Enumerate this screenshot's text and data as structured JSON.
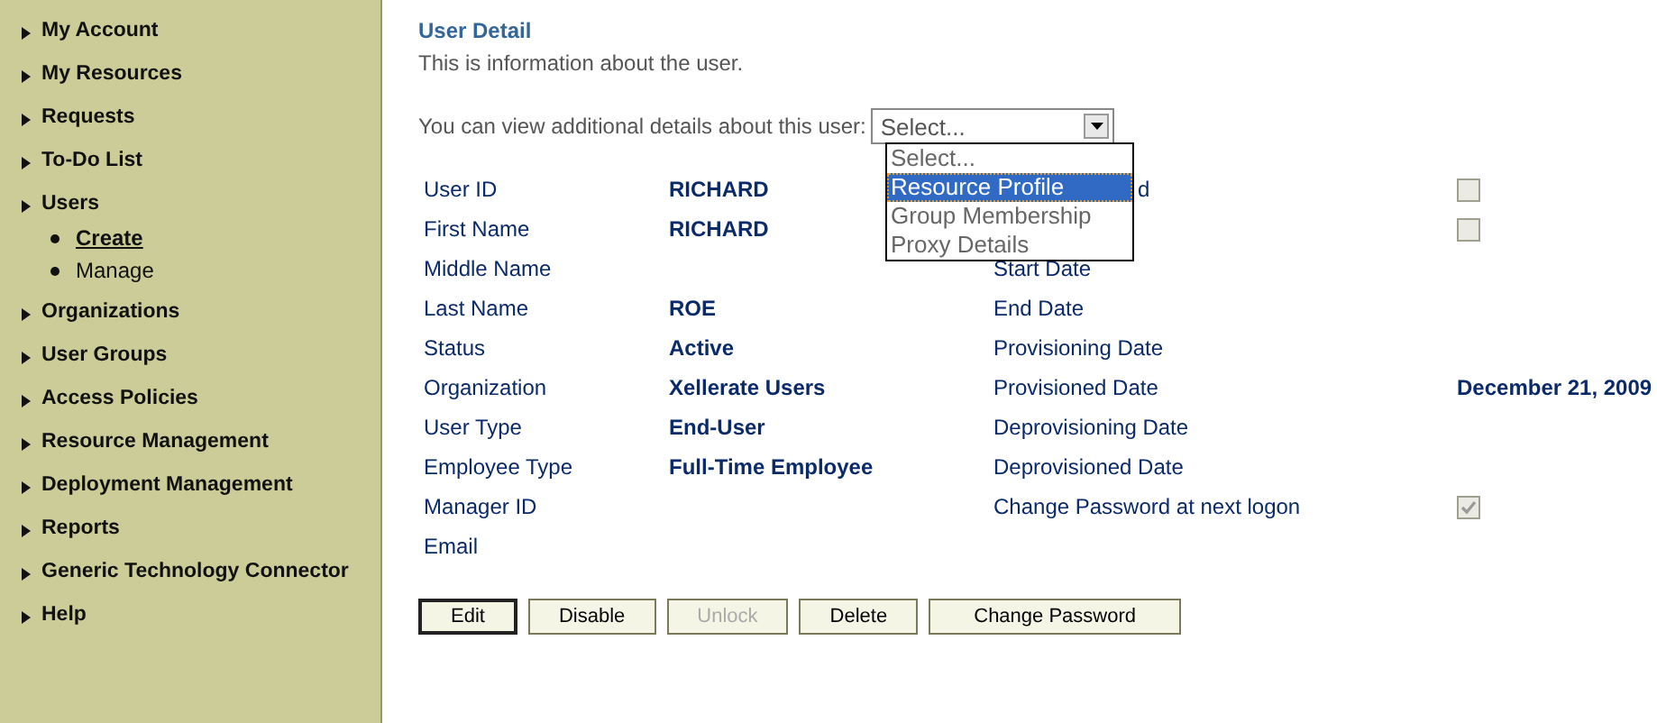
{
  "sidebar": {
    "items": [
      {
        "label": "My Account"
      },
      {
        "label": "My Resources"
      },
      {
        "label": "Requests"
      },
      {
        "label": "To-Do List"
      },
      {
        "label": "Users",
        "children": [
          {
            "label": "Create",
            "selected": true
          },
          {
            "label": "Manage",
            "selected": false
          }
        ]
      },
      {
        "label": "Organizations"
      },
      {
        "label": "User Groups"
      },
      {
        "label": "Access Policies"
      },
      {
        "label": "Resource Management"
      },
      {
        "label": "Deployment Management"
      },
      {
        "label": "Reports"
      },
      {
        "label": "Generic Technology Connector"
      },
      {
        "label": "Help"
      }
    ]
  },
  "title": "User Detail",
  "description": "This is information about the user.",
  "details_prompt": "You can view additional details about this user:",
  "details_select": {
    "value": "Select...",
    "options": [
      {
        "label": "Select...",
        "highlighted": false
      },
      {
        "label": "Resource Profile",
        "highlighted": true
      },
      {
        "label": "Group Membership",
        "highlighted": false
      },
      {
        "label": "Proxy Details",
        "highlighted": false
      }
    ]
  },
  "rows": [
    {
      "label": "User ID",
      "value": "RICHARD",
      "right_label": "d",
      "right_label_cut": true,
      "checked": false
    },
    {
      "label": "First Name",
      "value": "RICHARD",
      "checked": false
    },
    {
      "label": "Middle Name",
      "right_label": "Start Date"
    },
    {
      "label": "Last Name",
      "value": "ROE",
      "right_label": "End Date"
    },
    {
      "label": "Status",
      "value": "Active",
      "right_label": "Provisioning Date"
    },
    {
      "label": "Organization",
      "value": "Xellerate Users",
      "right_label": "Provisioned Date",
      "right_value": "December 21, 2009"
    },
    {
      "label": "User Type",
      "value": "End-User",
      "right_label": "Deprovisioning Date"
    },
    {
      "label": "Employee Type",
      "value": "Full-Time Employee",
      "right_label": "Deprovisioned Date"
    },
    {
      "label": "Manager ID",
      "right_label": "Change Password at next logon",
      "checked": true
    },
    {
      "label": "Email"
    }
  ],
  "buttons": [
    {
      "label": "Edit",
      "disabled": false,
      "focused": true
    },
    {
      "label": "Disable",
      "disabled": false,
      "focused": false
    },
    {
      "label": "Unlock",
      "disabled": true,
      "focused": false
    },
    {
      "label": "Delete",
      "disabled": false,
      "focused": false
    },
    {
      "label": "Change Password",
      "disabled": false,
      "focused": false
    }
  ]
}
